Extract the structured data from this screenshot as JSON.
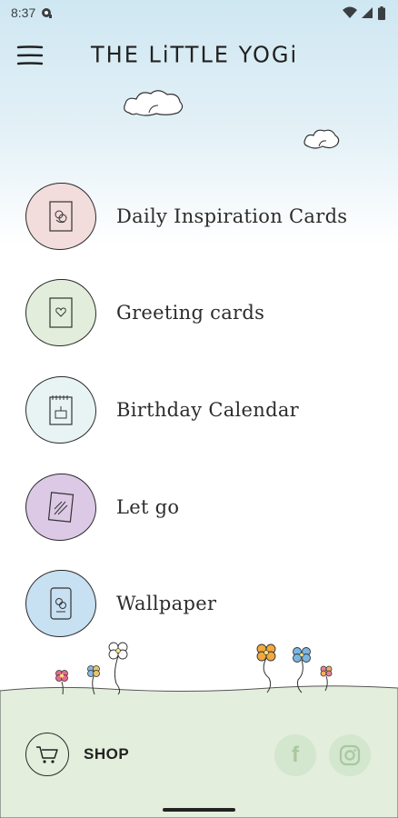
{
  "status_bar": {
    "time": "8:37",
    "icons": [
      "notification-icon",
      "wifi-icon",
      "signal-icon",
      "battery-icon"
    ]
  },
  "app_bar": {
    "title": "THE LiTTLE YOGi",
    "menu_icon": "hamburger-menu-icon"
  },
  "menu": {
    "items": [
      {
        "label": "Daily Inspiration Cards",
        "icon": "inspiration-card-icon",
        "color": "#f2dcdc"
      },
      {
        "label": "Greeting cards",
        "icon": "heart-card-icon",
        "color": "#e2eedb"
      },
      {
        "label": "Birthday Calendar",
        "icon": "calendar-cake-icon",
        "color": "#e8f4f4"
      },
      {
        "label": "Let go",
        "icon": "let-go-icon",
        "color": "#dcc9e6"
      },
      {
        "label": "Wallpaper",
        "icon": "wallpaper-icon",
        "color": "#c7e0f2"
      }
    ]
  },
  "footer": {
    "shop_label": "SHOP",
    "shop_icon": "cart-icon",
    "social": [
      {
        "icon": "facebook-icon",
        "glyph": "f"
      },
      {
        "icon": "instagram-icon"
      }
    ],
    "ground_color": "#e3eedc",
    "social_bg": "#d3e6ce"
  }
}
